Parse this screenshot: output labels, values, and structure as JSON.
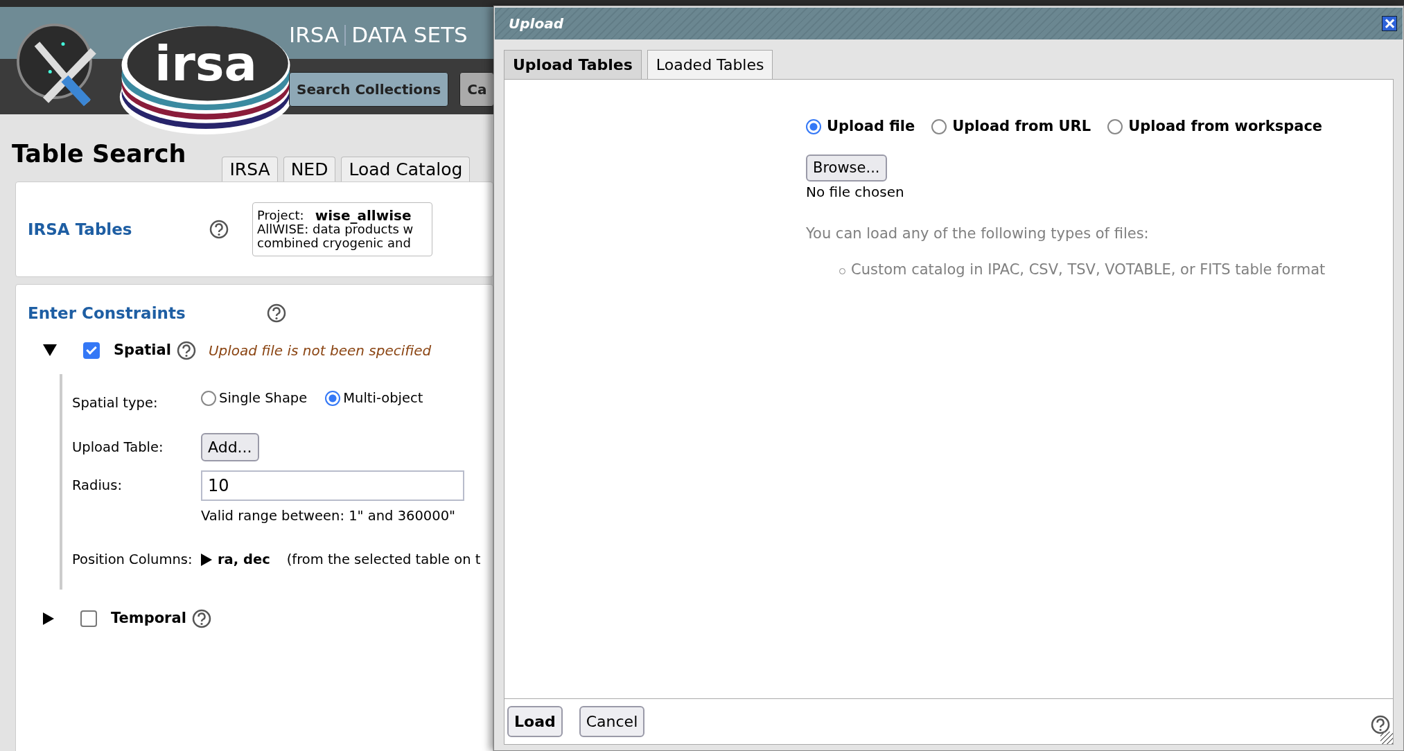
{
  "header": {
    "logo_text": "irsa",
    "nav": [
      "IRSA",
      "DATA SETS"
    ],
    "buttons": [
      {
        "label": "Search Collections",
        "selected": true
      },
      {
        "label": "Ca",
        "selected": false
      }
    ]
  },
  "page": {
    "title": "Table Search",
    "tabs": [
      "IRSA",
      "NED",
      "Load Catalog"
    ]
  },
  "tables_card": {
    "title": "IRSA Tables",
    "project_label": "Project:",
    "project": "wise_allwise",
    "description_lines": [
      "AllWISE: data products w",
      "combined cryogenic and"
    ]
  },
  "constraints": {
    "title": "Enter Constraints",
    "sections": [
      {
        "label": "Spatial",
        "expanded": true,
        "checked": true,
        "message": "Upload file is not been specified"
      },
      {
        "label": "Temporal",
        "expanded": false,
        "checked": false
      }
    ],
    "spatial_type_label": "Spatial type:",
    "spatial_types": [
      {
        "label": "Single Shape",
        "selected": false
      },
      {
        "label": "Multi-object",
        "selected": true
      }
    ],
    "upload_table_label": "Upload Table:",
    "add_button": "Add...",
    "radius_label": "Radius:",
    "radius": "10",
    "radius_hint": "Valid range between: 1\" and 360000\"",
    "position_label": "Position Columns:",
    "position_value": "ra, dec",
    "position_note": "(from the selected table on t"
  },
  "dialog": {
    "title": "Upload",
    "tabs": [
      {
        "label": "Upload Tables",
        "selected": true
      },
      {
        "label": "Loaded Tables",
        "selected": false
      }
    ],
    "sources": [
      {
        "label": "Upload file",
        "selected": true
      },
      {
        "label": "Upload from URL",
        "selected": false
      },
      {
        "label": "Upload from workspace",
        "selected": false
      }
    ],
    "browse_button": "Browse...",
    "file_status": "No file chosen",
    "info": "You can load any of the following types of files:",
    "file_types": [
      "Custom catalog in IPAC, CSV, TSV, VOTABLE, or FITS table format"
    ],
    "buttons": [
      {
        "label": "Load",
        "kind": "primary"
      },
      {
        "label": "Cancel",
        "kind": "secondary"
      }
    ]
  }
}
